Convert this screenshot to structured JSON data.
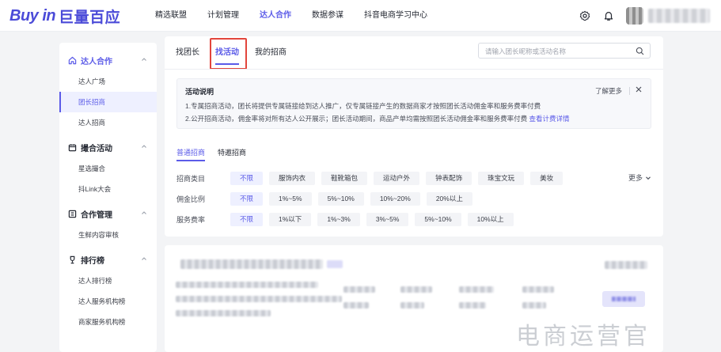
{
  "brand": {
    "logo_en": "Buy in",
    "logo_cn": "巨量百应"
  },
  "nav": [
    {
      "label": "精选联盟",
      "active": false
    },
    {
      "label": "计划管理",
      "active": false
    },
    {
      "label": "达人合作",
      "active": true
    },
    {
      "label": "数据参谋",
      "active": false
    },
    {
      "label": "抖音电商学习中心",
      "active": false
    }
  ],
  "header_icons": [
    "gear-icon",
    "bell-icon",
    "avatar"
  ],
  "sidebar": {
    "groups": [
      {
        "label": "达人合作",
        "icon": "home-icon",
        "active": true,
        "items": [
          "达人广场",
          "团长招商",
          "达人招商"
        ]
      },
      {
        "label": "撮合活动",
        "icon": "calendar-icon",
        "active": false,
        "items": [
          "星选撮合",
          "抖Link大会"
        ]
      },
      {
        "label": "合作管理",
        "icon": "list-icon",
        "active": false,
        "items": [
          "生鲜内容审核"
        ]
      },
      {
        "label": "排行榜",
        "icon": "trophy-icon",
        "active": false,
        "items": [
          "达人排行榜",
          "达人服务机构榜",
          "商家服务机构榜"
        ]
      }
    ],
    "active_item": "团长招商"
  },
  "tabs": [
    {
      "label": "找团长",
      "active": false
    },
    {
      "label": "找活动",
      "active": true
    },
    {
      "label": "我的招商",
      "active": false
    }
  ],
  "search": {
    "placeholder": "请输入团长昵称或活动名称"
  },
  "notice": {
    "title": "活动说明",
    "line1": "1.专属招商活动，团长将提供专属链接给到达人推广，仅专属链接产生的数据商家才按照团长活动佣金率和服务费率付费",
    "line2": "2.公开招商活动，佣金率将对所有达人公开展示；团长活动期间，商品产单均需按照团长活动佣金率和服务费率付费",
    "line2_link": "查看计费详情",
    "more": "了解更多"
  },
  "subtabs": [
    {
      "label": "普通招商",
      "active": true
    },
    {
      "label": "特邀招商",
      "active": false
    }
  ],
  "filters": [
    {
      "label": "招商类目",
      "options": [
        "不限",
        "服饰内衣",
        "鞋靴箱包",
        "运动户外",
        "钟表配饰",
        "珠宝文玩",
        "美妆"
      ]
    },
    {
      "label": "佣金比例",
      "options": [
        "不限",
        "1%~5%",
        "5%~10%",
        "10%~20%",
        "20%以上"
      ]
    },
    {
      "label": "服务费率",
      "options": [
        "不限",
        "1%以下",
        "1%~3%",
        "3%~5%",
        "5%~10%",
        "10%以上"
      ]
    }
  ],
  "more_filters": "更多",
  "watermark": "电商运营官",
  "colors": {
    "accent": "#5b5be8",
    "highlight": "#e2453c"
  }
}
